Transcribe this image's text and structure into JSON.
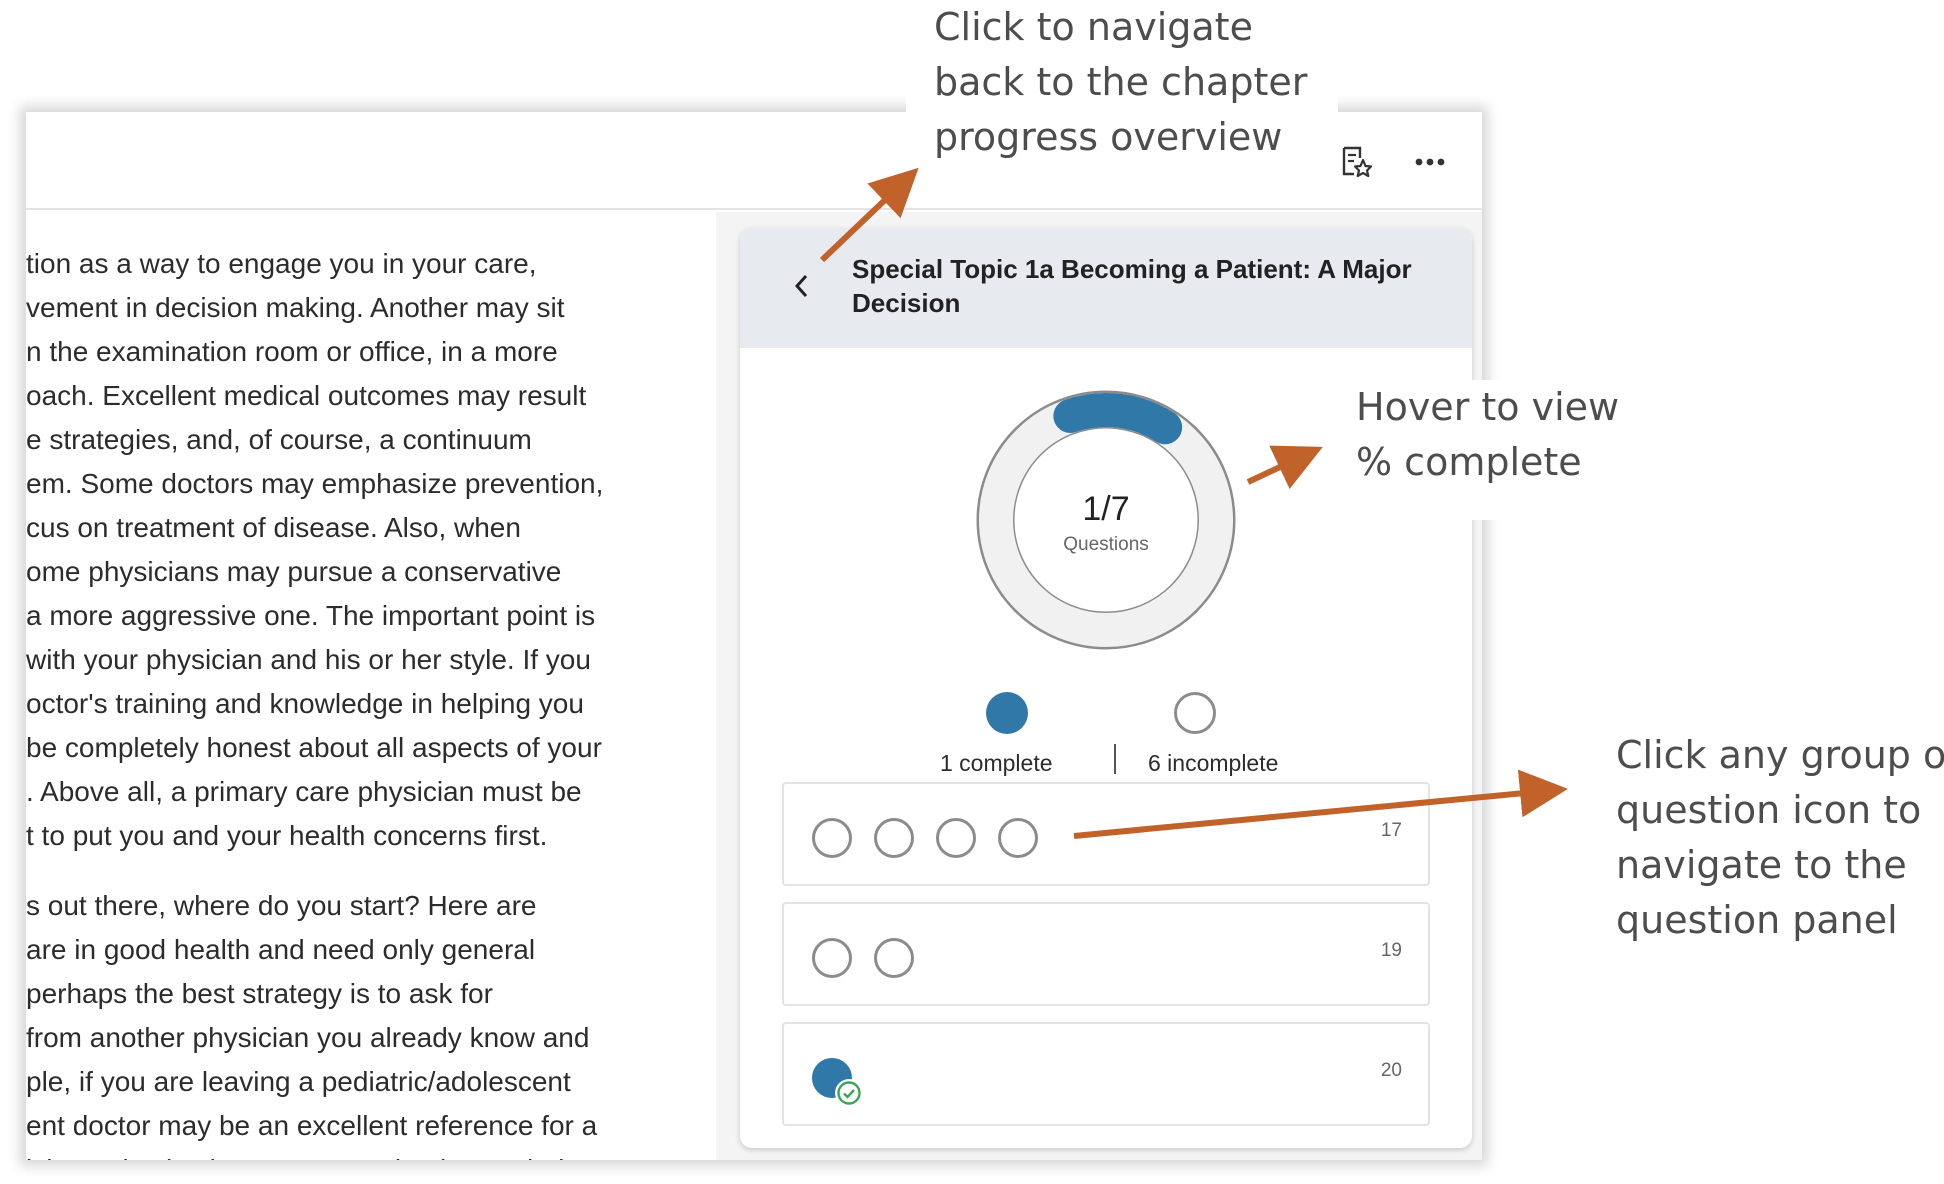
{
  "toolbar": {
    "icons": [
      "study-guide-icon",
      "more-options-icon"
    ]
  },
  "reading": {
    "lines": [
      "tion as a way to engage you in your care,",
      "vement in decision making. Another may sit",
      "n the examination room or office, in a more",
      "oach. Excellent medical outcomes may result",
      "e strategies, and, of course, a continuum",
      "em. Some doctors may emphasize prevention,",
      "cus on treatment of disease. Also, when",
      "ome physicians may pursue a conservative",
      " a more aggressive one. The important point is",
      " with your physician and his or her style. If you",
      "octor's training and knowledge in helping you",
      " be completely honest about all aspects of your",
      ". Above all, a primary care physician must be",
      "t to put you and your health concerns first.",
      "s out there, where do you start? Here are",
      " are in good health and need only general",
      " perhaps the best strategy is to ask for",
      " from another physician you already know and",
      "ple, if you are leaving a pediatric/adolescent",
      "ent doctor may be an excellent reference for a",
      "ician. It is also important to ask others. Find"
    ]
  },
  "panel": {
    "title": "Special Topic 1a Becoming a Patient: A Major Decision",
    "progress": {
      "count": "1/7",
      "label": "Questions",
      "fraction_complete": 0.142857
    },
    "legend": {
      "complete": "1 complete",
      "incomplete": "6 incomplete"
    },
    "groups": [
      {
        "page": "17",
        "questions": [
          "incomplete",
          "incomplete",
          "incomplete",
          "incomplete"
        ]
      },
      {
        "page": "19",
        "questions": [
          "incomplete",
          "incomplete"
        ]
      },
      {
        "page": "20",
        "questions": [
          "complete"
        ]
      }
    ],
    "colors": {
      "accent": "#2f78a8",
      "check": "#3aa655"
    }
  },
  "annotations": {
    "back": [
      "Click to navigate",
      "back to the chapter",
      "progress overview"
    ],
    "hover": [
      "Hover to view",
      "% complete"
    ],
    "group": [
      "Click any group or",
      "question icon to",
      "navigate to the",
      "question panel"
    ],
    "arrow_color": "#c0622a"
  }
}
